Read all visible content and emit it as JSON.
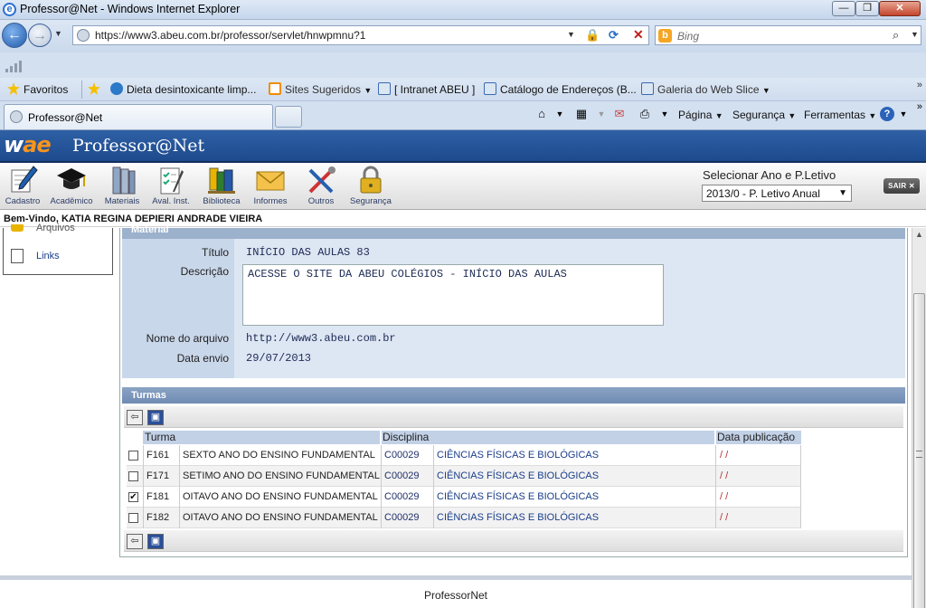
{
  "window": {
    "title": "Professor@Net - Windows Internet Explorer",
    "min": "—",
    "max": "❐",
    "close": "✕"
  },
  "browser": {
    "url": "https://www3.abeu.com.br/professor/servlet/hnwpmnu?1",
    "search_placeholder": "Bing",
    "favorites_label": "Favoritos",
    "favorites": [
      {
        "label": "Dieta desintoxicante limp..."
      },
      {
        "label": "Sites Sugeridos"
      },
      {
        "label": "[ Intranet ABEU ]"
      },
      {
        "label": "Catálogo de Endereços (B..."
      },
      {
        "label": "Galeria do Web Slice"
      }
    ],
    "tab_label": "Professor@Net",
    "commands": [
      "Página",
      "Segurança",
      "Ferramentas"
    ]
  },
  "app": {
    "logo_w": "w",
    "logo_ae": "ae",
    "title": "Professor@Net",
    "toolbar": [
      "Cadastro",
      "Acadêmico",
      "Materiais",
      "Aval. Inst.",
      "Biblioteca",
      "Informes",
      "Outros",
      "Segurança"
    ],
    "select_label": "Selecionar Ano e P.Letivo",
    "select_value": "2013/0 - P. Letivo Anual",
    "logout": "SAIR ✕",
    "welcome": "Bem-Vindo, KATIA REGINA DEPIERI ANDRADE VIEIRA"
  },
  "sidebar": {
    "cut_item": "Arquivos",
    "links_label": "Links"
  },
  "material": {
    "header": "Material",
    "titulo_label": "Título",
    "titulo_value": "INÍCIO DAS AULAS   83",
    "descricao_label": "Descrição",
    "descricao_value": "ACESSE O SITE DA ABEU COLÉGIOS - INÍCIO DAS AULAS",
    "arquivo_label": "Nome do arquivo",
    "arquivo_value": "http://www3.abeu.com.br",
    "data_label": "Data envio",
    "data_value": "29/07/2013"
  },
  "turmas": {
    "header": "Turmas",
    "columns": {
      "turma": "Turma",
      "disciplina": "Disciplina",
      "data": "Data publicação"
    },
    "rows": [
      {
        "checked": false,
        "code": "F161",
        "name": "SEXTO ANO DO ENSINO FUNDAMENTAL",
        "disc_code": "C00029",
        "disc_name": "CIÊNCIAS FÍSICAS E BIOLÓGICAS",
        "pub": "/ /"
      },
      {
        "checked": false,
        "code": "F171",
        "name": "SETIMO ANO DO ENSINO FUNDAMENTAL",
        "disc_code": "C00029",
        "disc_name": "CIÊNCIAS FÍSICAS E BIOLÓGICAS",
        "pub": "/ /"
      },
      {
        "checked": true,
        "code": "F181",
        "name": "OITAVO ANO DO ENSINO FUNDAMENTAL",
        "disc_code": "C00029",
        "disc_name": "CIÊNCIAS FÍSICAS E BIOLÓGICAS",
        "pub": "/ /"
      },
      {
        "checked": false,
        "code": "F182",
        "name": "OITAVO ANO DO ENSINO FUNDAMENTAL",
        "disc_code": "C00029",
        "disc_name": "CIÊNCIAS FÍSICAS E BIOLÓGICAS",
        "pub": "/ /"
      }
    ]
  },
  "footer": "ProfessorNet",
  "colors": {
    "app_header": "#1d4a8d",
    "logo_accent": "#f7941d",
    "panel_bg": "#dde6f3",
    "label_bg": "#c9d7ea"
  },
  "icons": {
    "back": "back-arrow-icon",
    "forward": "forward-arrow-icon",
    "lock": "lock-icon",
    "refresh": "refresh-icon",
    "stop": "stop-icon",
    "search": "search-icon",
    "home": "home-icon",
    "feed": "rss-feed-icon",
    "mail": "mail-icon",
    "print": "printer-icon",
    "help": "help-icon",
    "save": "save-icon"
  }
}
